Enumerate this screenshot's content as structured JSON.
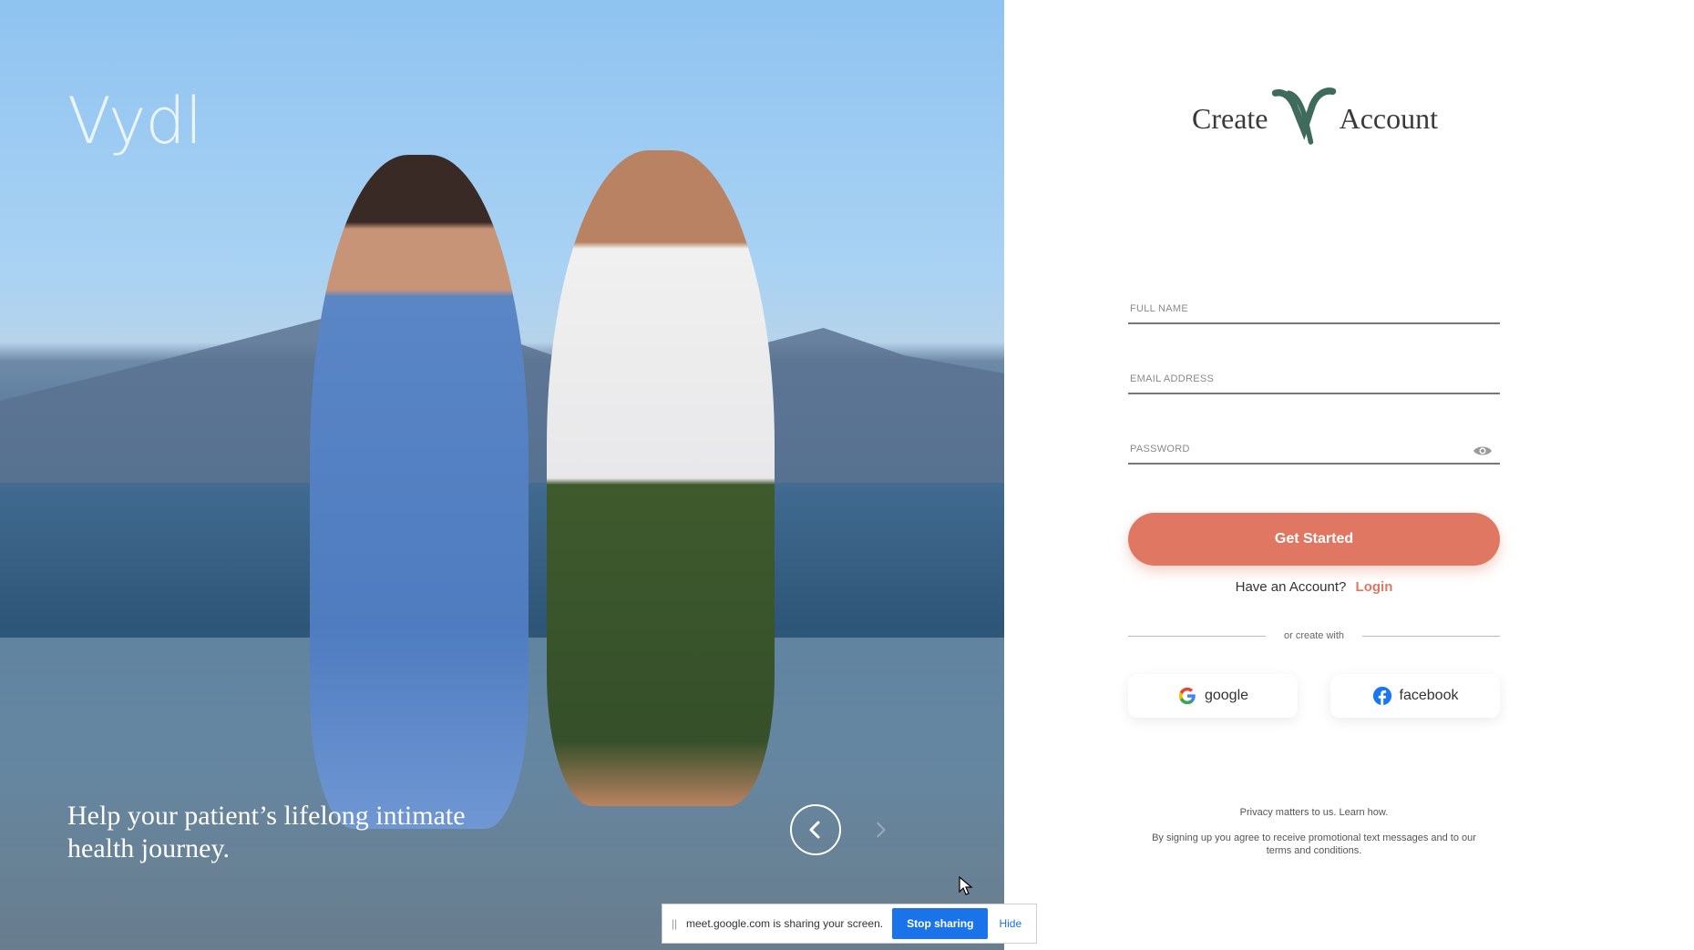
{
  "hero": {
    "brand": "Vydl",
    "tagline": "Help your patient’s lifelong intimate health journey."
  },
  "form": {
    "title_left": "Create",
    "title_right": "Account",
    "full_name_placeholder": "FULL NAME",
    "email_placeholder": "EMAIL ADDRESS",
    "password_placeholder": "PASSWORD",
    "submit_label": "Get Started",
    "have_account_text": "Have an Account?",
    "login_label": "Login",
    "divider_text": "or create with",
    "google_label": "google",
    "facebook_label": "facebook",
    "privacy_text": "Privacy matters to us. Learn how.",
    "terms_text": "By signing up you agree to receive promotional text messages and to our terms and conditions."
  },
  "share_bar": {
    "message": "meet.google.com is sharing your screen.",
    "stop_label": "Stop sharing",
    "hide_label": "Hide"
  },
  "colors": {
    "accent": "#e07762",
    "brand_green": "#3f6b5c",
    "share_blue": "#1a73e8"
  }
}
